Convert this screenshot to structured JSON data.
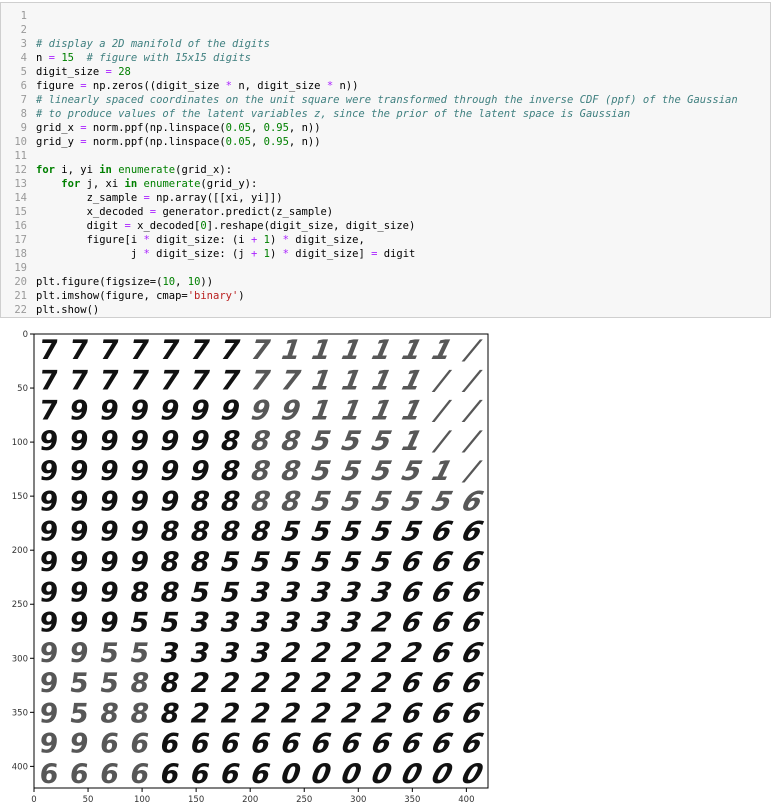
{
  "code_cell": {
    "lines": [
      "",
      "",
      "# display a 2D manifold of the digits",
      "n = 15  # figure with 15x15 digits",
      "digit_size = 28",
      "figure = np.zeros((digit_size * n, digit_size * n))",
      "# linearly spaced coordinates on the unit square were transformed through the inverse CDF (ppf) of the Gaussian",
      "# to produce values of the latent variables z, since the prior of the latent space is Gaussian",
      "grid_x = norm.ppf(np.linspace(0.05, 0.95, n))",
      "grid_y = norm.ppf(np.linspace(0.05, 0.95, n))",
      "",
      "for i, yi in enumerate(grid_x):",
      "    for j, xi in enumerate(grid_y):",
      "        z_sample = np.array([[xi, yi]])",
      "        x_decoded = generator.predict(z_sample)",
      "        digit = x_decoded[0].reshape(digit_size, digit_size)",
      "        figure[i * digit_size: (i + 1) * digit_size,",
      "               j * digit_size: (j + 1) * digit_size] = digit",
      "",
      "plt.figure(figsize=(10, 10))",
      "plt.imshow(figure, cmap='binary')",
      "plt.show()"
    ]
  },
  "output": {
    "cmap": "binary",
    "grid_n": 15,
    "digit_size": 28,
    "axes": {
      "xlim": [
        0,
        420
      ],
      "ylim": [
        420,
        0
      ],
      "x_ticks": [
        0,
        50,
        100,
        150,
        200,
        250,
        300,
        350,
        400
      ],
      "y_ticks": [
        0,
        50,
        100,
        150,
        200,
        250,
        300,
        350,
        400
      ]
    },
    "digit_rows": [
      [
        "7",
        "7",
        "7",
        "7",
        "7",
        "7",
        "7",
        "7",
        "1",
        "1",
        "1",
        "1",
        "1",
        "1",
        "/"
      ],
      [
        "7",
        "7",
        "7",
        "7",
        "7",
        "7",
        "7",
        "7",
        "7",
        "1",
        "1",
        "1",
        "1",
        "/",
        "/"
      ],
      [
        "7",
        "9",
        "9",
        "9",
        "9",
        "9",
        "9",
        "9",
        "9",
        "1",
        "1",
        "1",
        "1",
        "/",
        "/"
      ],
      [
        "9",
        "9",
        "9",
        "9",
        "9",
        "9",
        "8",
        "8",
        "8",
        "5",
        "5",
        "5",
        "1",
        "/",
        "/"
      ],
      [
        "9",
        "9",
        "9",
        "9",
        "9",
        "9",
        "8",
        "8",
        "8",
        "5",
        "5",
        "5",
        "5",
        "1",
        "/"
      ],
      [
        "9",
        "9",
        "9",
        "9",
        "9",
        "8",
        "8",
        "8",
        "8",
        "5",
        "5",
        "5",
        "5",
        "5",
        "6"
      ],
      [
        "9",
        "9",
        "9",
        "9",
        "8",
        "8",
        "8",
        "8",
        "5",
        "5",
        "5",
        "5",
        "5",
        "6",
        "6"
      ],
      [
        "9",
        "9",
        "9",
        "9",
        "8",
        "8",
        "5",
        "5",
        "5",
        "5",
        "5",
        "5",
        "6",
        "6",
        "6"
      ],
      [
        "9",
        "9",
        "9",
        "8",
        "8",
        "5",
        "5",
        "3",
        "3",
        "3",
        "3",
        "3",
        "6",
        "6",
        "6"
      ],
      [
        "9",
        "9",
        "9",
        "5",
        "5",
        "3",
        "3",
        "3",
        "3",
        "3",
        "3",
        "2",
        "6",
        "6",
        "6"
      ],
      [
        "9",
        "9",
        "5",
        "5",
        "3",
        "3",
        "3",
        "3",
        "2",
        "2",
        "2",
        "2",
        "2",
        "6",
        "6"
      ],
      [
        "9",
        "5",
        "5",
        "8",
        "8",
        "2",
        "2",
        "2",
        "2",
        "2",
        "2",
        "2",
        "6",
        "6",
        "6"
      ],
      [
        "9",
        "5",
        "8",
        "8",
        "8",
        "2",
        "2",
        "2",
        "2",
        "2",
        "2",
        "2",
        "6",
        "6",
        "6"
      ],
      [
        "9",
        "9",
        "6",
        "6",
        "6",
        "6",
        "6",
        "6",
        "6",
        "6",
        "6",
        "6",
        "6",
        "6",
        "6"
      ],
      [
        "6",
        "6",
        "6",
        "6",
        "6",
        "6",
        "6",
        "6",
        "0",
        "0",
        "0",
        "0",
        "0",
        "0",
        "0"
      ]
    ]
  }
}
